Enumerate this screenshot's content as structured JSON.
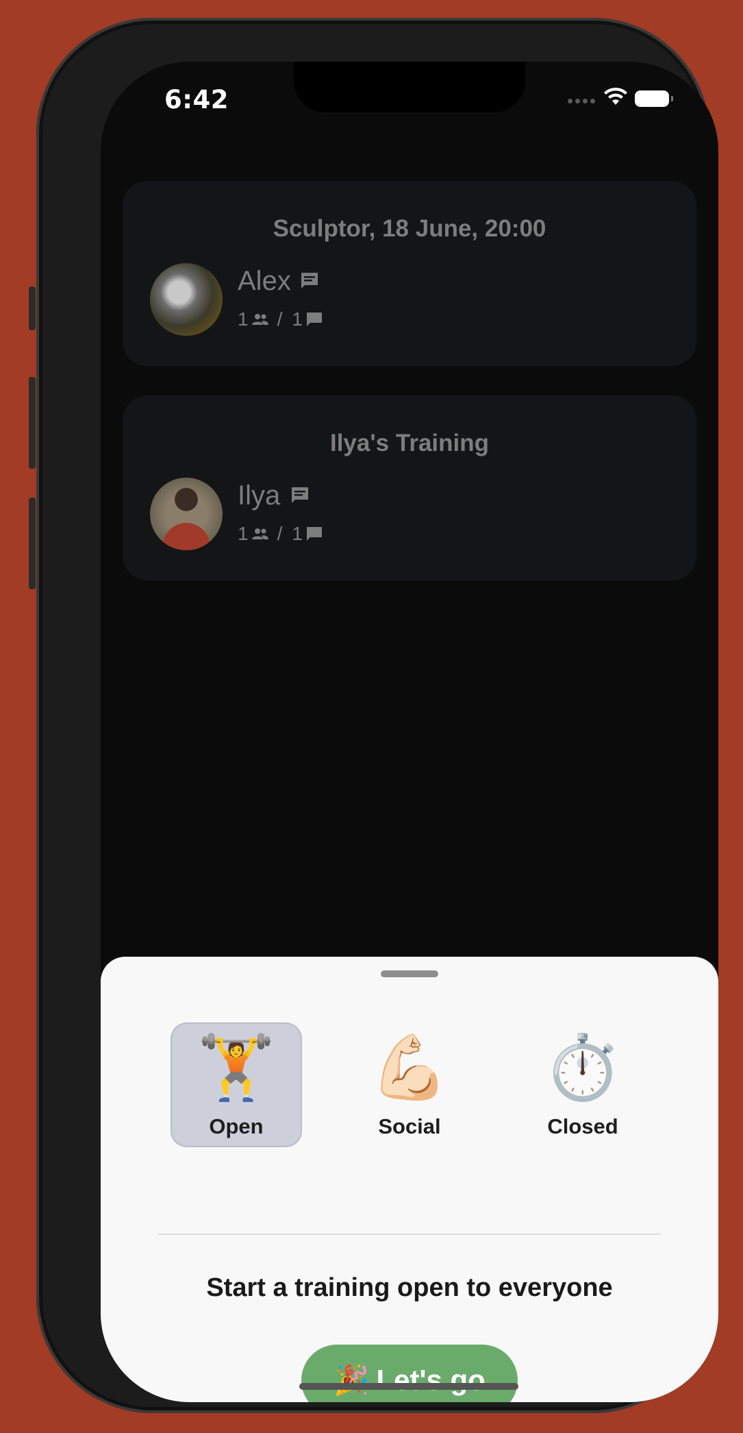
{
  "status_bar": {
    "time": "6:42"
  },
  "trainings": [
    {
      "title": "Sculptor, 18 June, 20:00",
      "owner": "Alex",
      "participants": "1",
      "messages": "1",
      "separator": "/"
    },
    {
      "title": "Ilya's Training",
      "owner": "Ilya",
      "participants": "1",
      "messages": "1",
      "separator": "/"
    }
  ],
  "sheet": {
    "options": [
      {
        "emoji": "🏋️",
        "label": "Open",
        "selected": true
      },
      {
        "emoji": "💪🏻",
        "label": "Social",
        "selected": false
      },
      {
        "emoji": "⏱️",
        "label": "Closed",
        "selected": false
      }
    ],
    "description": "Start a training open to everyone",
    "button": {
      "emoji": "🎉",
      "label": "Let's go"
    }
  },
  "colors": {
    "background": "#a23c25",
    "card": "#141516",
    "accent_button": "#6aab6c",
    "selected_option": "#cdd0db"
  },
  "icons": [
    "wifi-icon",
    "battery-icon",
    "chat-icon",
    "people-icon",
    "message-icon"
  ]
}
